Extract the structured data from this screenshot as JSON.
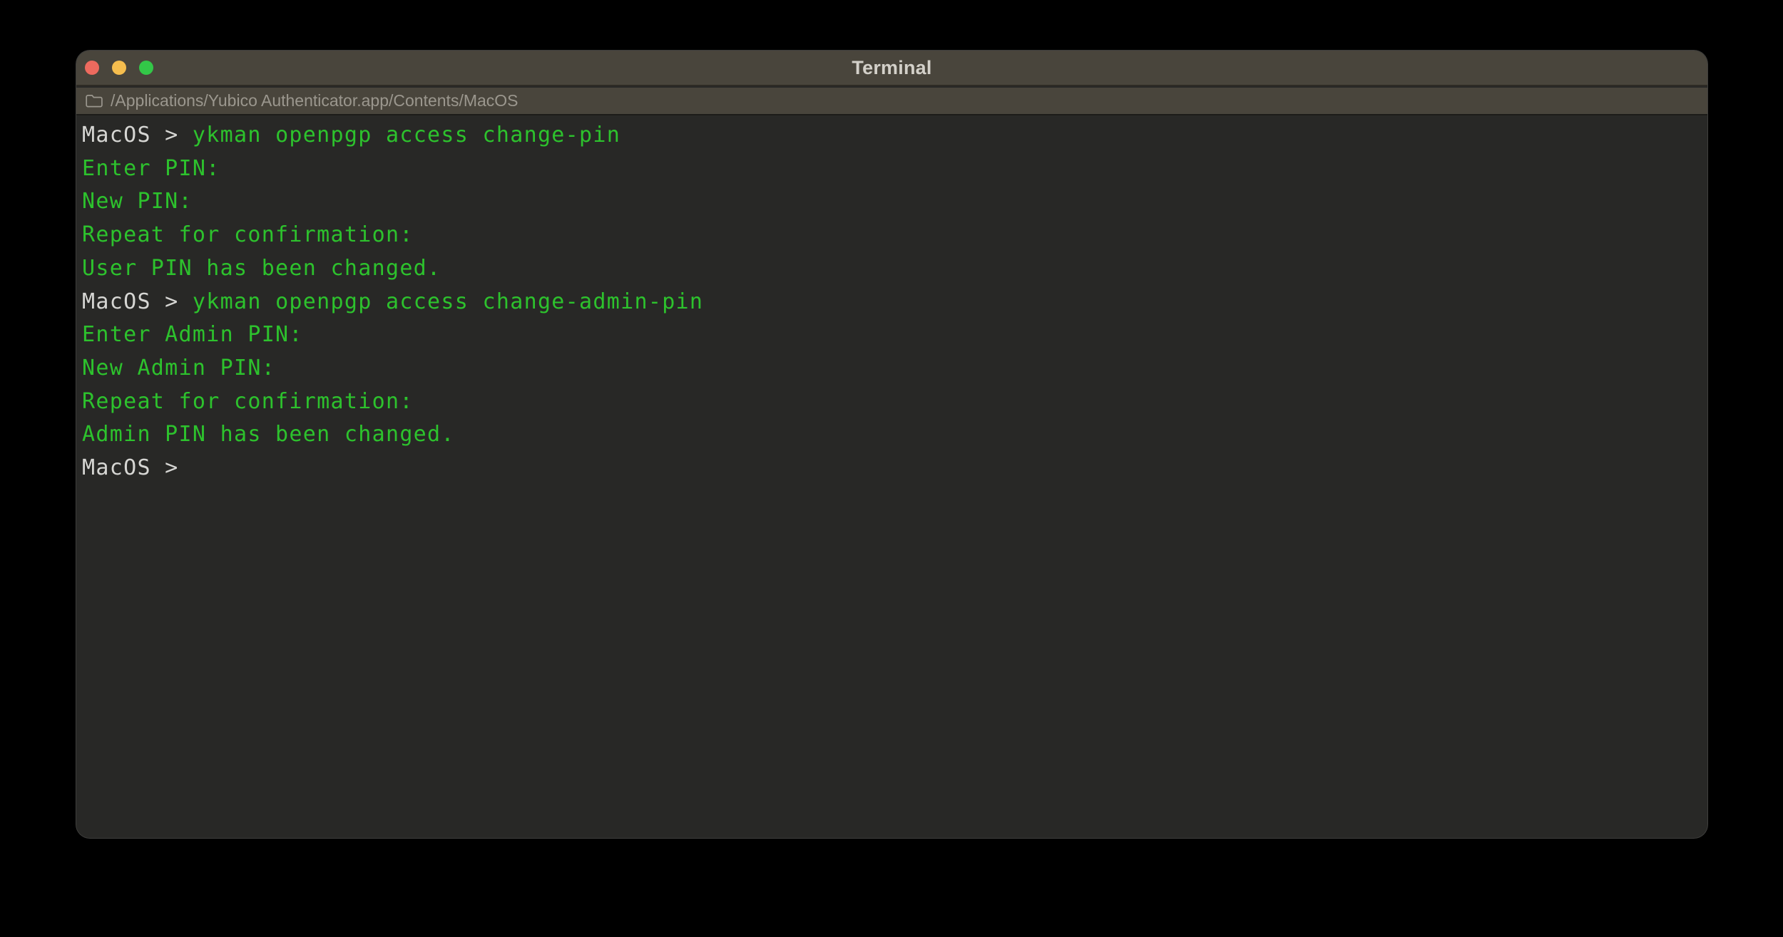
{
  "window": {
    "title": "Terminal"
  },
  "titlebar_icons": {
    "close": "close-circle",
    "minimize": "minimize-circle",
    "zoom": "zoom-circle"
  },
  "path_bar": {
    "icon": "folder-icon",
    "path": "/Applications/Yubico Authenticator.app/Contents/MacOS"
  },
  "terminal": {
    "lines": [
      {
        "prompt": "MacOS > ",
        "command": "ykman openpgp access change-pin"
      },
      {
        "text": "Enter PIN:"
      },
      {
        "text": "New PIN:"
      },
      {
        "text": "Repeat for confirmation:"
      },
      {
        "text": "User PIN has been changed."
      },
      {
        "prompt": "MacOS > ",
        "command": "ykman openpgp access change-admin-pin"
      },
      {
        "text": "Enter Admin PIN:"
      },
      {
        "text": "New Admin PIN:"
      },
      {
        "text": "Repeat for confirmation:"
      },
      {
        "text": "Admin PIN has been changed."
      },
      {
        "prompt": "MacOS > ",
        "command": ""
      }
    ]
  },
  "colors": {
    "desktop_background": "#000000",
    "window_chrome": "#49453c",
    "terminal_background": "#282826",
    "terminal_green": "#2dc22d",
    "prompt_gray": "#d6d6d3",
    "path_text": "#9b978e",
    "traffic_red": "#ed6a5e",
    "traffic_yellow": "#f5bd4e",
    "traffic_green": "#33c748"
  }
}
